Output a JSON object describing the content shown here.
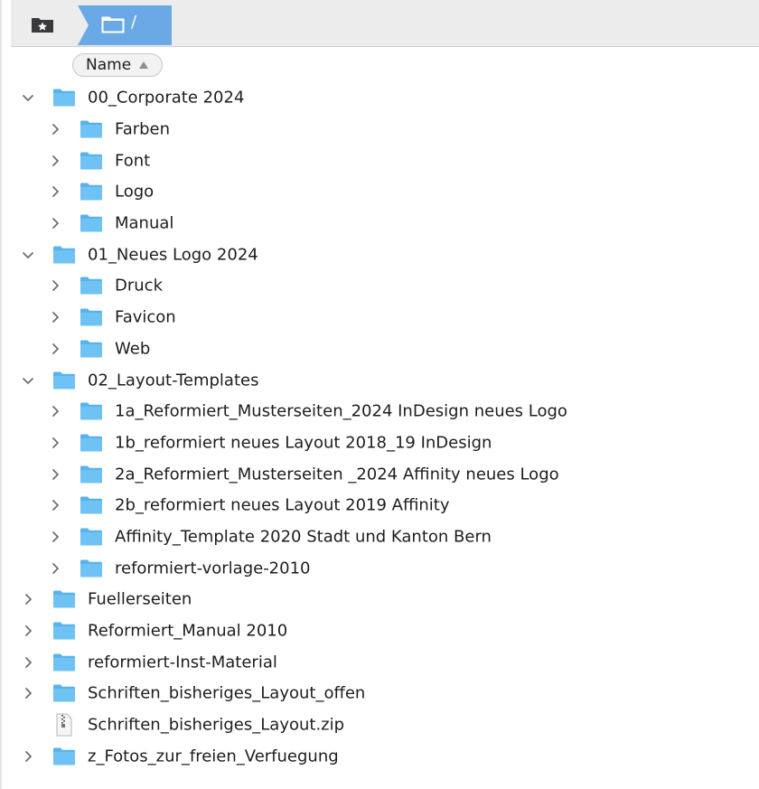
{
  "pathbar": {
    "current_path_label": "/"
  },
  "header": {
    "name_label": "Name"
  },
  "colors": {
    "folder_top": "#58b3ec",
    "folder_body": "#6ec2f4",
    "path_crumb": "#6aa8e6",
    "chevron": "#6e6e73"
  },
  "rows": [
    {
      "level": 0,
      "expanded": true,
      "kind": "folder",
      "name": "00_Corporate 2024"
    },
    {
      "level": 1,
      "expanded": false,
      "kind": "folder",
      "name": "Farben"
    },
    {
      "level": 1,
      "expanded": false,
      "kind": "folder",
      "name": "Font"
    },
    {
      "level": 1,
      "expanded": false,
      "kind": "folder",
      "name": "Logo"
    },
    {
      "level": 1,
      "expanded": false,
      "kind": "folder",
      "name": "Manual"
    },
    {
      "level": 0,
      "expanded": true,
      "kind": "folder",
      "name": "01_Neues Logo 2024"
    },
    {
      "level": 1,
      "expanded": false,
      "kind": "folder",
      "name": "Druck"
    },
    {
      "level": 1,
      "expanded": false,
      "kind": "folder",
      "name": "Favicon"
    },
    {
      "level": 1,
      "expanded": false,
      "kind": "folder",
      "name": "Web"
    },
    {
      "level": 0,
      "expanded": true,
      "kind": "folder",
      "name": "02_Layout-Templates"
    },
    {
      "level": 1,
      "expanded": false,
      "kind": "folder",
      "name": "1a_Reformiert_Musterseiten_2024 InDesign neues Logo"
    },
    {
      "level": 1,
      "expanded": false,
      "kind": "folder",
      "name": "1b_reformiert neues Layout 2018_19 InDesign"
    },
    {
      "level": 1,
      "expanded": false,
      "kind": "folder",
      "name": "2a_Reformiert_Musterseiten _2024 Affinity neues Logo"
    },
    {
      "level": 1,
      "expanded": false,
      "kind": "folder",
      "name": "2b_reformiert neues Layout 2019 Affinity"
    },
    {
      "level": 1,
      "expanded": false,
      "kind": "folder",
      "name": "Affinity_Template 2020 Stadt und Kanton Bern"
    },
    {
      "level": 1,
      "expanded": false,
      "kind": "folder",
      "name": "reformiert-vorlage-2010"
    },
    {
      "level": 0,
      "expanded": false,
      "kind": "folder",
      "name": "Fuellerseiten"
    },
    {
      "level": 0,
      "expanded": false,
      "kind": "folder",
      "name": "Reformiert_Manual 2010"
    },
    {
      "level": 0,
      "expanded": false,
      "kind": "folder",
      "name": "reformiert-Inst-Material"
    },
    {
      "level": 0,
      "expanded": false,
      "kind": "folder",
      "name": "Schriften_bisheriges_Layout_offen"
    },
    {
      "level": 0,
      "expanded": null,
      "kind": "zip",
      "name": "Schriften_bisheriges_Layout.zip"
    },
    {
      "level": 0,
      "expanded": false,
      "kind": "folder",
      "name": "z_Fotos_zur_freien_Verfuegung"
    }
  ]
}
